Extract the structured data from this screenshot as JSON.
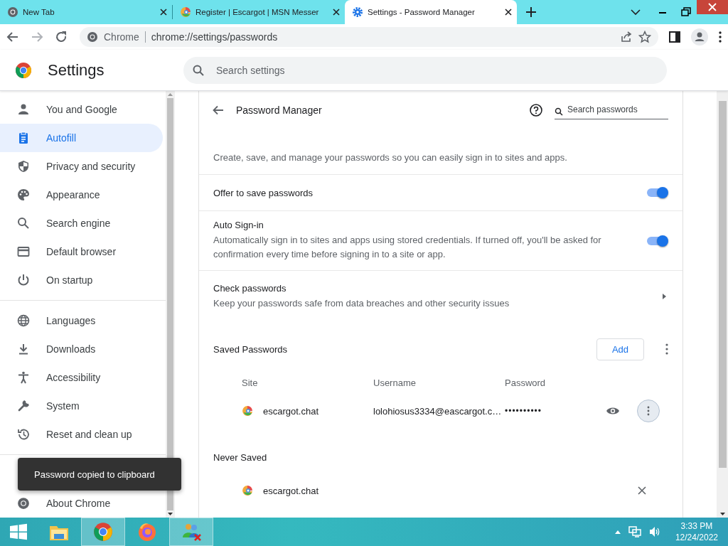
{
  "tabs": [
    {
      "title": "New Tab",
      "selected": false
    },
    {
      "title": "Register | Escargot | MSN Messer",
      "selected": false
    },
    {
      "title": "Settings - Password Manager",
      "selected": true
    }
  ],
  "address_bar": {
    "origin_label": "Chrome",
    "url": "chrome://settings/passwords"
  },
  "settings_header": {
    "title": "Settings",
    "search_placeholder": "Search settings"
  },
  "sidebar": {
    "items": [
      {
        "label": "You and Google",
        "selected": false
      },
      {
        "label": "Autofill",
        "selected": true
      },
      {
        "label": "Privacy and security",
        "selected": false
      },
      {
        "label": "Appearance",
        "selected": false
      },
      {
        "label": "Search engine",
        "selected": false
      },
      {
        "label": "Default browser",
        "selected": false
      },
      {
        "label": "On startup",
        "selected": false
      },
      {
        "label": "Languages",
        "selected": false
      },
      {
        "label": "Downloads",
        "selected": false
      },
      {
        "label": "Accessibility",
        "selected": false
      },
      {
        "label": "System",
        "selected": false
      },
      {
        "label": "Reset and clean up",
        "selected": false
      }
    ],
    "about": "About Chrome"
  },
  "page": {
    "title": "Password Manager",
    "search_placeholder": "Search passwords",
    "intro": "Create, save, and manage your passwords so you can easily sign in to sites and apps.",
    "settings": [
      {
        "kind": "toggle",
        "label": "Offer to save passwords",
        "on": true
      },
      {
        "kind": "toggle",
        "label": "Auto Sign-in",
        "description": "Automatically sign in to sites and apps using stored credentials. If turned off, you'll be asked for confirmation every time before signing in to a site or app.",
        "on": true
      },
      {
        "kind": "link",
        "label": "Check passwords",
        "description": "Keep your passwords safe from data breaches and other security issues"
      }
    ],
    "saved": {
      "title": "Saved Passwords",
      "add_button": "Add",
      "columns": [
        "Site",
        "Username",
        "Password"
      ],
      "rows": [
        {
          "site": "escargot.chat",
          "username": "lolohiosus3334@eascargot.c…",
          "password": "••••••••••"
        }
      ]
    },
    "never_saved": {
      "title": "Never Saved",
      "rows": [
        {
          "site": "escargot.chat"
        }
      ]
    }
  },
  "toast": "Password copied to clipboard",
  "taskbar": {
    "apps": [
      {
        "selected": false
      },
      {
        "selected": true
      },
      {
        "selected": false
      },
      {
        "selected": true
      }
    ],
    "time": "3:33 PM",
    "date": "12/24/2022"
  }
}
